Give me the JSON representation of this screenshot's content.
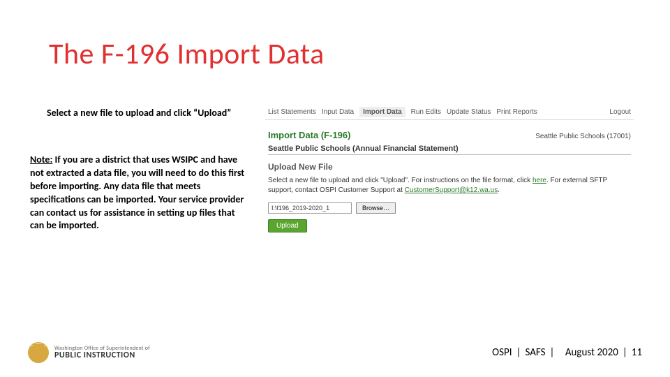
{
  "title": "The F-196 Import Data",
  "instruction": "Select a new file to upload and click “Upload”",
  "note_label": "Note:",
  "note_body": "If you are a district that uses WSIPC and have not extracted a data file, you will need to do this first before importing. Any data file that meets specifications can be imported. Your service provider can contact us for assistance in setting up files that can be imported.",
  "panel": {
    "tabs": [
      "List Statements",
      "Input Data",
      "Import Data",
      "Run Edits",
      "Update Status",
      "Print Reports"
    ],
    "active_tab": "Import Data",
    "logout": "Logout",
    "heading": "Import Data (F-196)",
    "district": "Seattle Public Schools (17001)",
    "school_line": "Seattle Public Schools (Annual Financial Statement)",
    "upload_header": "Upload New File",
    "help_pre": "Select a new file to upload and click \"Upload\". For instructions on the file format, click ",
    "help_link": "here",
    "help_mid": ". For external SFTP support, contact OSPI Customer Support at ",
    "support_email": "CustomerSupport@k12.wa.us",
    "help_post": ".",
    "file_value": "I:\\f196_2019-2020_1",
    "browse_label": "Browse…",
    "upload_label": "Upload"
  },
  "footer": {
    "logo_top": "Washington Office of Superintendent of",
    "logo_bottom": "PUBLIC INSTRUCTION",
    "org1": "OSPI",
    "org2": "SAFS",
    "date": "August 2020",
    "page": "11"
  }
}
